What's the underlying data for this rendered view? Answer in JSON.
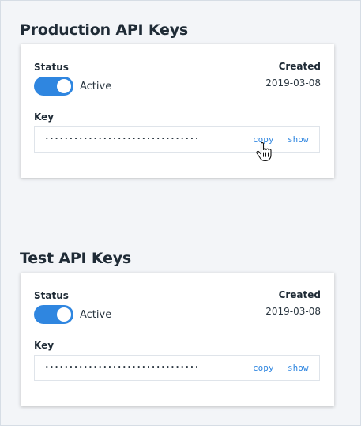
{
  "sections": [
    {
      "title": "Production API Keys",
      "status_label": "Status",
      "status_value": "Active",
      "status_on": true,
      "created_label": "Created",
      "created_date": "2019-03-08",
      "key_label": "Key",
      "key_masked": "································",
      "copy_label": "copy",
      "show_label": "show"
    },
    {
      "title": "Test API Keys",
      "status_label": "Status",
      "status_value": "Active",
      "status_on": true,
      "created_label": "Created",
      "created_date": "2019-03-08",
      "key_label": "Key",
      "key_masked": "································",
      "copy_label": "copy",
      "show_label": "show"
    }
  ],
  "colors": {
    "accent": "#2f86e0",
    "background": "#f3f5f8",
    "card": "#ffffff",
    "text": "#1f2b36"
  },
  "icons": {
    "pointer": "hand-pointer-icon"
  }
}
